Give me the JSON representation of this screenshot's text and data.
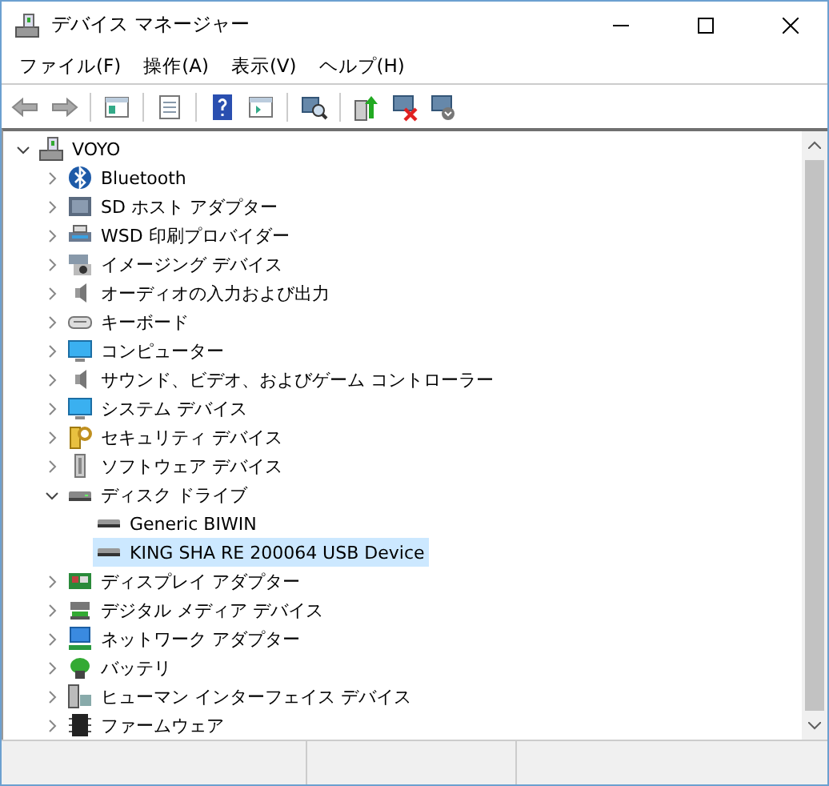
{
  "window": {
    "title": "デバイス マネージャー"
  },
  "menu": [
    "ファイル(F)",
    "操作(A)",
    "表示(V)",
    "ヘルプ(H)"
  ],
  "tree": {
    "label": "VOYO",
    "expanded": true,
    "selected": false,
    "children": [
      {
        "label": "Bluetooth",
        "expanded": false,
        "selected": false
      },
      {
        "label": "SD ホスト アダプター",
        "expanded": false,
        "selected": false
      },
      {
        "label": "WSD 印刷プロバイダー",
        "expanded": false,
        "selected": false
      },
      {
        "label": "イメージング デバイス",
        "expanded": false,
        "selected": false
      },
      {
        "label": "オーディオの入力および出力",
        "expanded": false,
        "selected": false
      },
      {
        "label": "キーボード",
        "expanded": false,
        "selected": false
      },
      {
        "label": "コンピューター",
        "expanded": false,
        "selected": false
      },
      {
        "label": "サウンド、ビデオ、およびゲーム コントローラー",
        "expanded": false,
        "selected": false
      },
      {
        "label": "システム デバイス",
        "expanded": false,
        "selected": false
      },
      {
        "label": "セキュリティ デバイス",
        "expanded": false,
        "selected": false
      },
      {
        "label": "ソフトウェア デバイス",
        "expanded": false,
        "selected": false
      },
      {
        "label": "ディスク ドライブ",
        "expanded": true,
        "selected": false,
        "children": [
          {
            "label": "Generic BIWIN",
            "selected": false
          },
          {
            "label": "KING SHA RE 200064 USB Device",
            "selected": true
          }
        ]
      },
      {
        "label": "ディスプレイ アダプター",
        "expanded": false,
        "selected": false
      },
      {
        "label": "デジタル メディア デバイス",
        "expanded": false,
        "selected": false
      },
      {
        "label": "ネットワーク アダプター",
        "expanded": false,
        "selected": false
      },
      {
        "label": "バッテリ",
        "expanded": false,
        "selected": false
      },
      {
        "label": "ヒューマン インターフェイス デバイス",
        "expanded": false,
        "selected": false
      },
      {
        "label": "ファームウェア",
        "expanded": false,
        "selected": false
      }
    ]
  }
}
